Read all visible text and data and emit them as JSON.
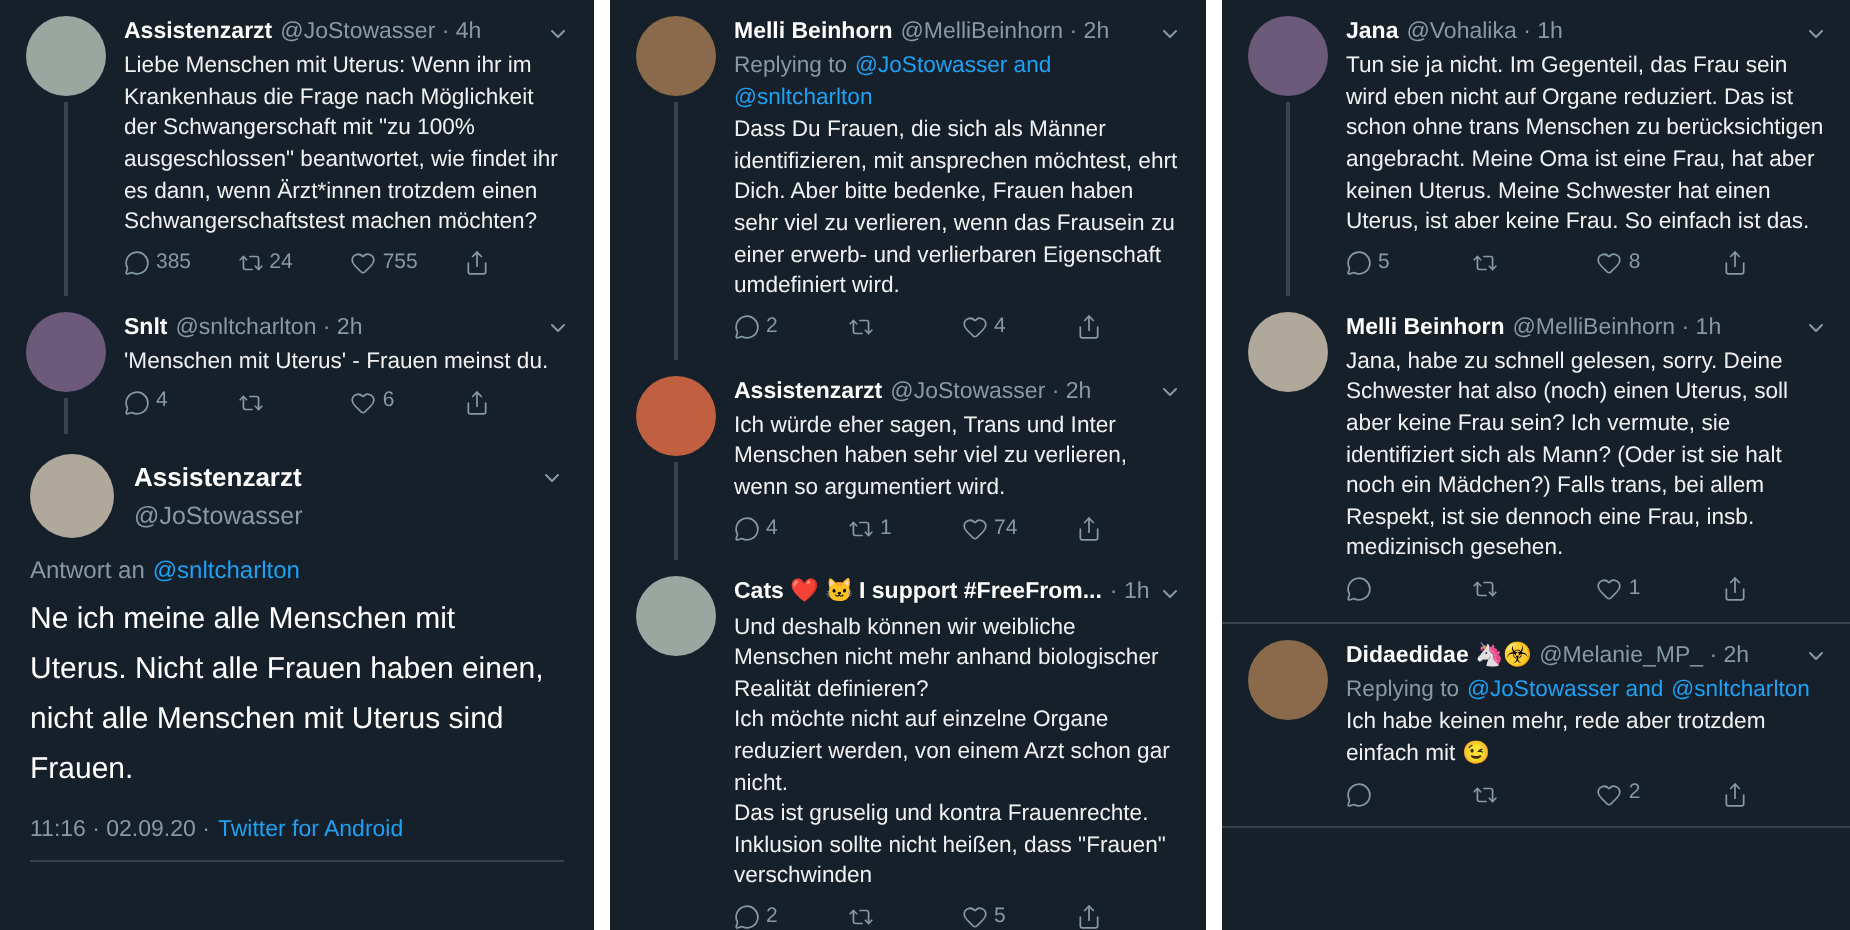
{
  "panels": [
    {
      "tweets": [
        {
          "kind": "reply",
          "name": "Assistenzarzt",
          "meta": "@JoStowasser · 4h",
          "thread_line": true,
          "text": "Liebe Menschen mit Uterus: Wenn ihr im Krankenhaus die Frage nach Möglichkeit der Schwangerschaft mit \"zu 100% ausgeschlossen\" beantwortet, wie findet ihr es dann, wenn Ärzt*innen trotzdem einen Schwangerschaftstest machen möchten?",
          "actions": {
            "replies": "385",
            "retweets": "24",
            "likes": "755"
          }
        },
        {
          "kind": "reply",
          "name": "Snlt",
          "meta": "@snltcharlton · 2h",
          "thread_line": true,
          "text": "'Menschen mit Uterus' - Frauen meinst du.",
          "actions": {
            "replies": "4",
            "likes": "6"
          }
        },
        {
          "kind": "detail",
          "name": "Assistenzarzt",
          "meta": "@JoStowasser",
          "reply_label": "Antwort an",
          "reply_links": [
            "@snltcharlton"
          ],
          "text": "Ne ich meine alle Menschen mit Uterus. Nicht alle Frauen haben einen, nicht alle Menschen mit Uterus sind Frauen.",
          "timestamp": "11:16 · 02.09.20 ·",
          "source": "Twitter for Android"
        }
      ]
    },
    {
      "tweets": [
        {
          "kind": "reply",
          "name": "Melli Beinhorn",
          "meta": "@MelliBeinhorn · 2h",
          "thread_line": true,
          "reply_label": "Replying to",
          "reply_links": [
            "@JoStowasser and",
            "@snltcharlton"
          ],
          "text": "Dass Du Frauen, die sich als Männer identifizieren, mit ansprechen möchtest, ehrt Dich. Aber bitte bedenke, Frauen haben sehr viel zu verlieren, wenn das Frausein zu einer erwerb- und verlierbaren Eigenschaft umdefiniert wird.",
          "actions": {
            "replies": "2",
            "likes": "4"
          }
        },
        {
          "kind": "reply",
          "name": "Assistenzarzt",
          "meta": "@JoStowasser · 2h",
          "thread_line": true,
          "text": "Ich würde eher sagen, Trans und Inter Menschen haben sehr viel zu verlieren, wenn so argumentiert wird.",
          "actions": {
            "replies": "4",
            "retweets": "1",
            "likes": "74"
          }
        },
        {
          "kind": "reply",
          "name": "Cats ❤️ 🐱 I support #FreeFrom...",
          "meta": "· 1h",
          "thread_line": false,
          "text": "Und deshalb können wir weibliche Menschen nicht mehr anhand biologischer Realität definieren?\nIch möchte nicht auf einzelne Organe reduziert werden, von einem Arzt schon gar nicht.\nDas ist gruselig und kontra Frauenrechte. Inklusion sollte nicht heißen, dass \"Frauen\" verschwinden",
          "actions": {
            "replies": "2",
            "likes": "5"
          }
        }
      ]
    },
    {
      "tweets": [
        {
          "kind": "reply",
          "name": "Jana",
          "meta": "@Vohalika · 1h",
          "thread_line": true,
          "text": "Tun sie ja nicht. Im Gegenteil, das Frau sein wird eben nicht auf Organe reduziert. Das ist schon ohne trans Menschen zu berücksichtigen angebracht. Meine Oma ist eine Frau, hat aber keinen Uterus. Meine Schwester hat einen Uterus, ist aber keine Frau. So einfach ist das.",
          "actions": {
            "replies": "5",
            "likes": "8"
          }
        },
        {
          "kind": "reply",
          "name": "Melli Beinhorn",
          "meta": "@MelliBeinhorn · 1h",
          "thread_line": false,
          "text": "Jana, habe zu schnell gelesen, sorry. Deine Schwester hat also (noch) einen Uterus, soll aber keine Frau sein? Ich vermute, sie identifiziert sich als Mann? (Oder ist sie halt noch ein Mädchen?) Falls trans, bei allem Respekt, ist sie dennoch eine Frau, insb. medizinisch gesehen.",
          "actions": {
            "likes": "1"
          }
        },
        {
          "kind": "reply",
          "name": "Didaedidae 🦄☣️",
          "meta": "@Melanie_MP_ · 2h",
          "thread_line": false,
          "reply_label": "Replying to",
          "reply_links": [
            "@JoStowasser and",
            "@snltcharlton"
          ],
          "text": "Ich habe keinen mehr, rede aber trotzdem einfach mit 😉",
          "actions": {
            "likes": "2"
          }
        }
      ]
    }
  ]
}
